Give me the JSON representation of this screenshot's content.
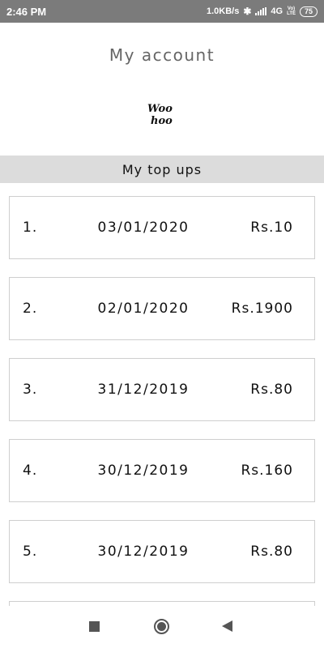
{
  "status_bar": {
    "time": "2:46 PM",
    "network_speed": "1.0KB/s",
    "network_type": "4G",
    "volte_top": "Vo)",
    "volte_bottom": "LTE",
    "battery": "75",
    "icons": [
      "bluetooth-icon",
      "signal-icon",
      "battery-icon"
    ]
  },
  "header": {
    "title": "My account",
    "logo_text_top": "Woo",
    "logo_text_bottom": "hoo"
  },
  "section": {
    "title": "My top ups"
  },
  "topups": [
    {
      "index": "1.",
      "date": "03/01/2020",
      "amount": "Rs.10"
    },
    {
      "index": "2.",
      "date": "02/01/2020",
      "amount": "Rs.1900"
    },
    {
      "index": "3.",
      "date": "31/12/2019",
      "amount": "Rs.80"
    },
    {
      "index": "4.",
      "date": "30/12/2019",
      "amount": "Rs.160"
    },
    {
      "index": "5.",
      "date": "30/12/2019",
      "amount": "Rs.80"
    }
  ],
  "nav": {
    "icons": [
      "recents-icon",
      "home-icon",
      "back-icon"
    ]
  }
}
